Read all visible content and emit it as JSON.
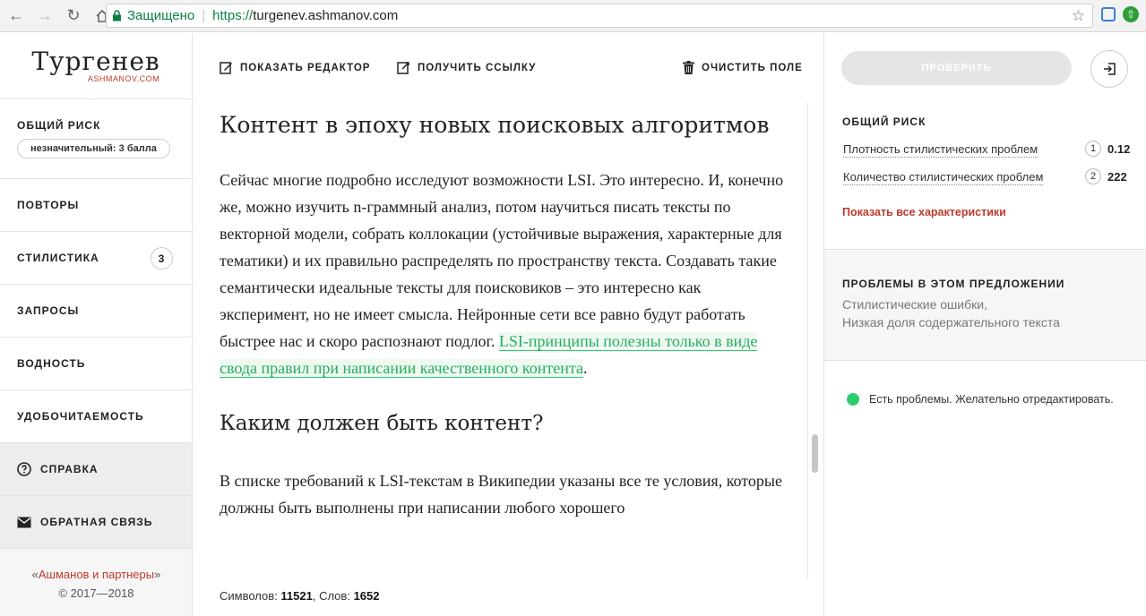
{
  "browser": {
    "secure_label": "Защищено",
    "url_proto": "https://",
    "url_host": "turgenev.ashmanov.com"
  },
  "sidebar": {
    "logo_title": "Тургенев",
    "logo_sub": "ASHMANOV.COM",
    "risk_label": "ОБЩИЙ РИСК",
    "risk_value": "незначительный: 3 балла",
    "items": [
      {
        "label": "ПОВТОРЫ"
      },
      {
        "label": "СТИЛИСТИКА",
        "badge": "3"
      },
      {
        "label": "ЗАПРОСЫ"
      },
      {
        "label": "ВОДНОСТЬ"
      },
      {
        "label": "УДОБОЧИТАЕМОСТЬ"
      }
    ],
    "help_label": "СПРАВКА",
    "feedback_label": "ОБРАТНАЯ СВЯЗЬ",
    "footer_brand_open": "«",
    "footer_brand": "Ашманов и партнеры",
    "footer_brand_close": "»",
    "footer_copy": "© 2017—2018"
  },
  "toolbar": {
    "show_editor": "ПОКАЗАТЬ РЕДАКТОР",
    "get_link": "ПОЛУЧИТЬ ССЫЛКУ",
    "clear_field": "ОЧИСТИТЬ ПОЛЕ"
  },
  "article": {
    "title": "Контент в эпоху новых поисковых алгоритмов",
    "para1": "Сейчас многие подробно исследуют возможности LSI. Это интересно. И, конечно же, можно изучить n-граммный анализ, потом научиться писать тексты по векторной модели, собрать коллокации (устойчивые выражения, характерные для тематики) и их правильно распределять по пространству текста. Создавать такие семантически идеальные тексты для поисковиков – это интересно как эксперимент, но не имеет смысла. Нейронные сети все равно будут работать быстрее нас и скоро распознают подлог. ",
    "para1_highlight": "LSI-принципы полезны только в виде свода правил при написании качественного контента",
    "para1_end": ".",
    "subtitle": "Каким должен быть контент?",
    "para2": "В списке требований к LSI-текстам в Википедии указаны все те условия, которые должны быть выполнены при написании любого хорошего"
  },
  "stats": {
    "chars_label": "Символов:",
    "chars_value": "11521",
    "words_label": ", Слов:",
    "words_value": "1652"
  },
  "right": {
    "check_button": "ПРОВЕРИТЬ",
    "risk_title": "ОБЩИЙ РИСК",
    "metrics": [
      {
        "label": "Плотность стилистических проблем",
        "num": "1",
        "value": "0.12"
      },
      {
        "label": "Количество стилистических проблем",
        "num": "2",
        "value": "222"
      }
    ],
    "show_all": "Показать все характеристики",
    "problems_title": "ПРОБЛЕМЫ В ЭТОМ ПРЕДЛОЖЕНИИ",
    "problems_line1": "Стилистические ошибки,",
    "problems_line2": "Низкая доля содержательного текста",
    "status_text": "Есть проблемы. Желательно отредактировать.",
    "status_color": "#2ecc71"
  },
  "colors": {
    "accent_red": "#c0392b",
    "highlight_green": "#27ae60"
  }
}
